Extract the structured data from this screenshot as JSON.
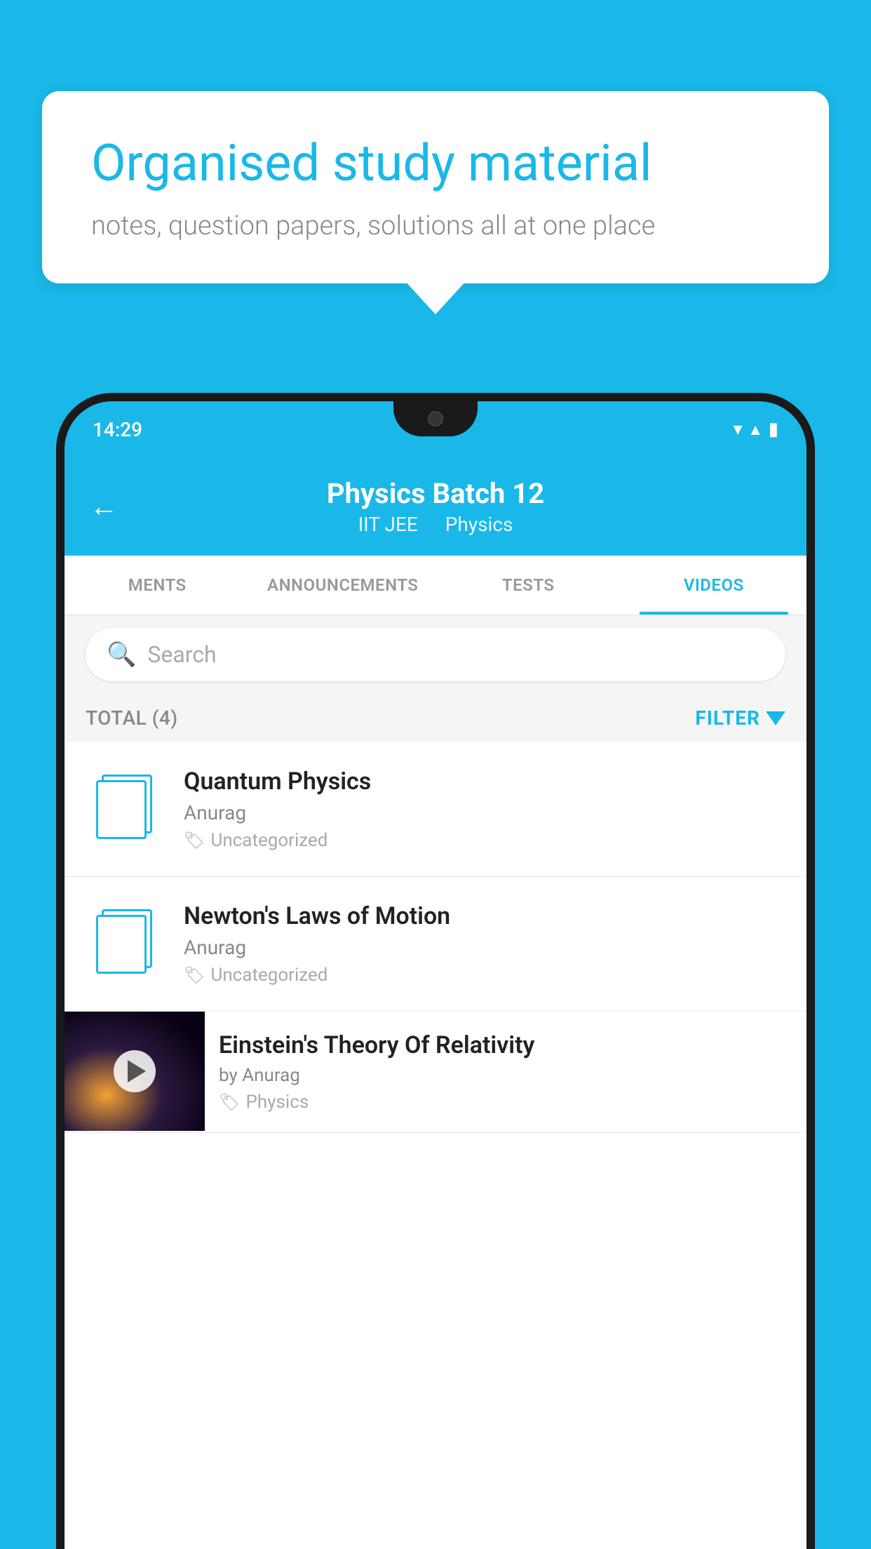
{
  "background_color": "#1ab8e8",
  "promo": {
    "title": "Organised study material",
    "subtitle": "notes, question papers, solutions all at one place"
  },
  "status_bar": {
    "time": "14:29",
    "wifi": "▼",
    "signal": "▲",
    "battery": "▌"
  },
  "header": {
    "back_label": "←",
    "title": "Physics Batch 12",
    "subtitle_left": "IIT JEE",
    "subtitle_right": "Physics"
  },
  "tabs": [
    {
      "label": "MENTS",
      "active": false
    },
    {
      "label": "ANNOUNCEMENTS",
      "active": false
    },
    {
      "label": "TESTS",
      "active": false
    },
    {
      "label": "VIDEOS",
      "active": true
    }
  ],
  "search": {
    "placeholder": "Search"
  },
  "filter": {
    "total_label": "TOTAL (4)",
    "filter_label": "FILTER"
  },
  "videos": [
    {
      "title": "Quantum Physics",
      "author": "Anurag",
      "tag": "Uncategorized",
      "has_thumb": false
    },
    {
      "title": "Newton's Laws of Motion",
      "author": "Anurag",
      "tag": "Uncategorized",
      "has_thumb": false
    },
    {
      "title": "Einstein's Theory Of Relativity",
      "author": "by Anurag",
      "tag": "Physics",
      "has_thumb": true
    }
  ]
}
